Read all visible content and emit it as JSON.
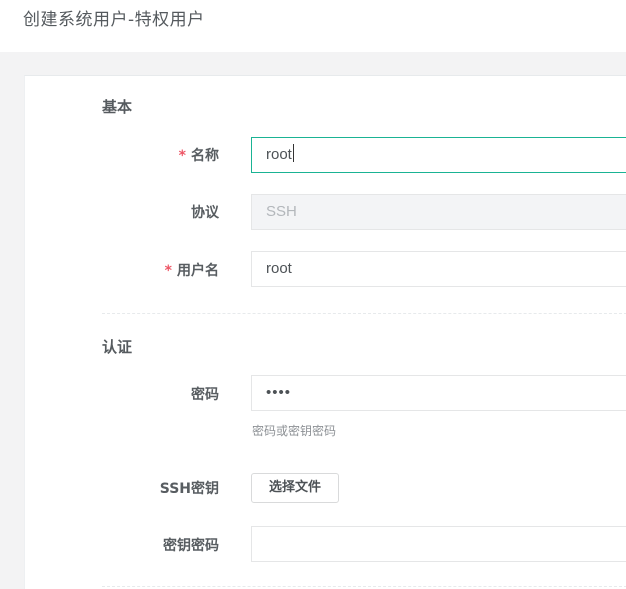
{
  "page": {
    "title": "创建系统用户-特权用户"
  },
  "form": {
    "basic": {
      "section_title": "基本",
      "name": {
        "required_mark": "*",
        "label": "名称",
        "value": "root"
      },
      "protocol": {
        "label": "协议",
        "value": "SSH"
      },
      "username": {
        "required_mark": "*",
        "label": "用户名",
        "value": "root"
      }
    },
    "auth": {
      "section_title": "认证",
      "password": {
        "label": "密码",
        "value": "••••",
        "help": "密码或密钥密码"
      },
      "ssh_key": {
        "label": "SSH密钥",
        "button_label": "选择文件"
      },
      "key_password": {
        "label": "密钥密码",
        "value": ""
      }
    }
  }
}
